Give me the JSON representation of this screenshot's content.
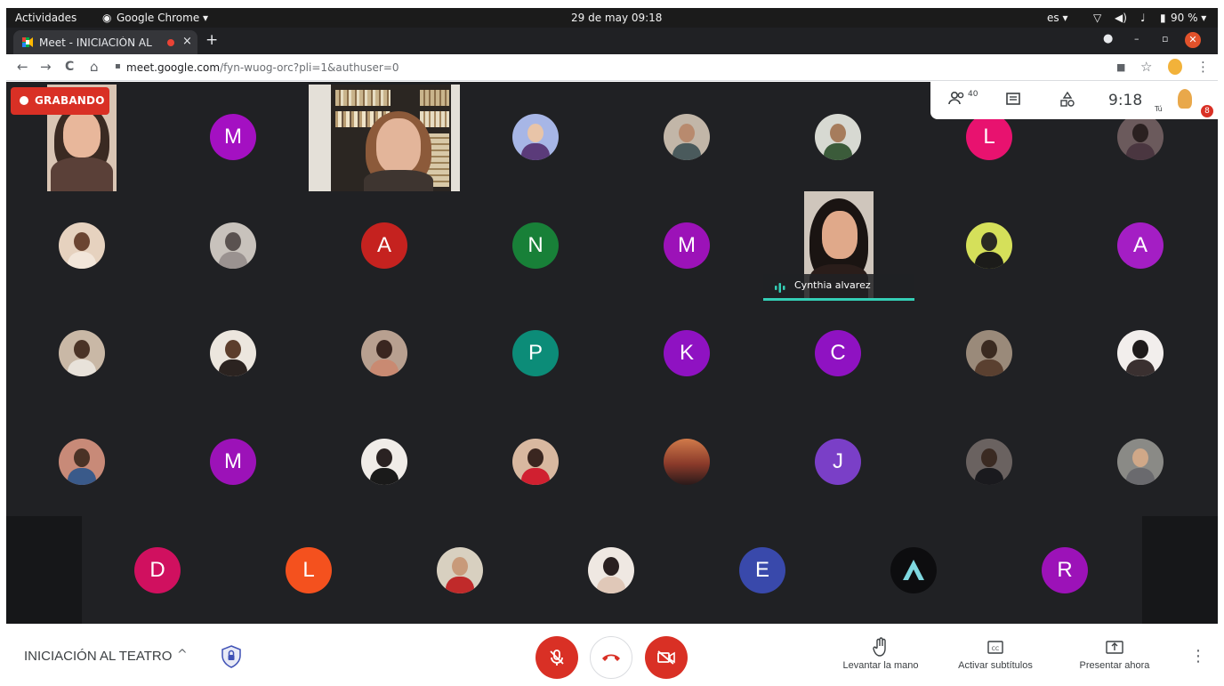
{
  "system_bar": {
    "activities": "Actividades",
    "app_menu": "Google Chrome ▾",
    "clock": "29 de may  09:18",
    "lang": "es ▾",
    "battery": "90 % ▾"
  },
  "browser": {
    "tab_title": "Meet - INICIACIÓN AL T",
    "tab_close": "×",
    "new_tab": "+",
    "url_domain": "meet.google.com",
    "url_path": "/fyn-wuog-orc?pli=1&authuser=0",
    "nav": {
      "back": "←",
      "forward": "→",
      "reload": "C",
      "home": "⌂",
      "lock": "🔒",
      "star": "☆",
      "menu": "⋮"
    }
  },
  "meet": {
    "recording_label": "GRABANDO",
    "participant_count": "40",
    "time": "9:18",
    "self_label": "Tú",
    "self_badge_count": "8",
    "active_speaker": "Cynthia alvarez",
    "meeting_title": "INICIACIÓN AL TEATRO",
    "chevron": "^",
    "actions": {
      "raise_hand": "Levantar la mano",
      "captions": "Activar subtítulos",
      "present": "Presentar ahora"
    },
    "kebab": "⋮",
    "letter_avatars": [
      {
        "letter": "M",
        "color": "#a410c2"
      },
      {
        "letter": "L",
        "color": "#e8126f"
      },
      {
        "letter": "A",
        "color": "#c5221f"
      },
      {
        "letter": "N",
        "color": "#188038"
      },
      {
        "letter": "M",
        "color": "#9c12b8"
      },
      {
        "letter": "A",
        "color": "#a41ec4"
      },
      {
        "letter": "P",
        "color": "#0c8c78"
      },
      {
        "letter": "K",
        "color": "#8f12c2"
      },
      {
        "letter": "C",
        "color": "#8f12c2"
      },
      {
        "letter": "M",
        "color": "#9c12b8"
      },
      {
        "letter": "J",
        "color": "#7a3fc7"
      },
      {
        "letter": "D",
        "color": "#d0105f"
      },
      {
        "letter": "L",
        "color": "#f4511e"
      },
      {
        "letter": "E",
        "color": "#3949ab"
      },
      {
        "letter": "R",
        "color": "#9c12b8"
      }
    ]
  }
}
